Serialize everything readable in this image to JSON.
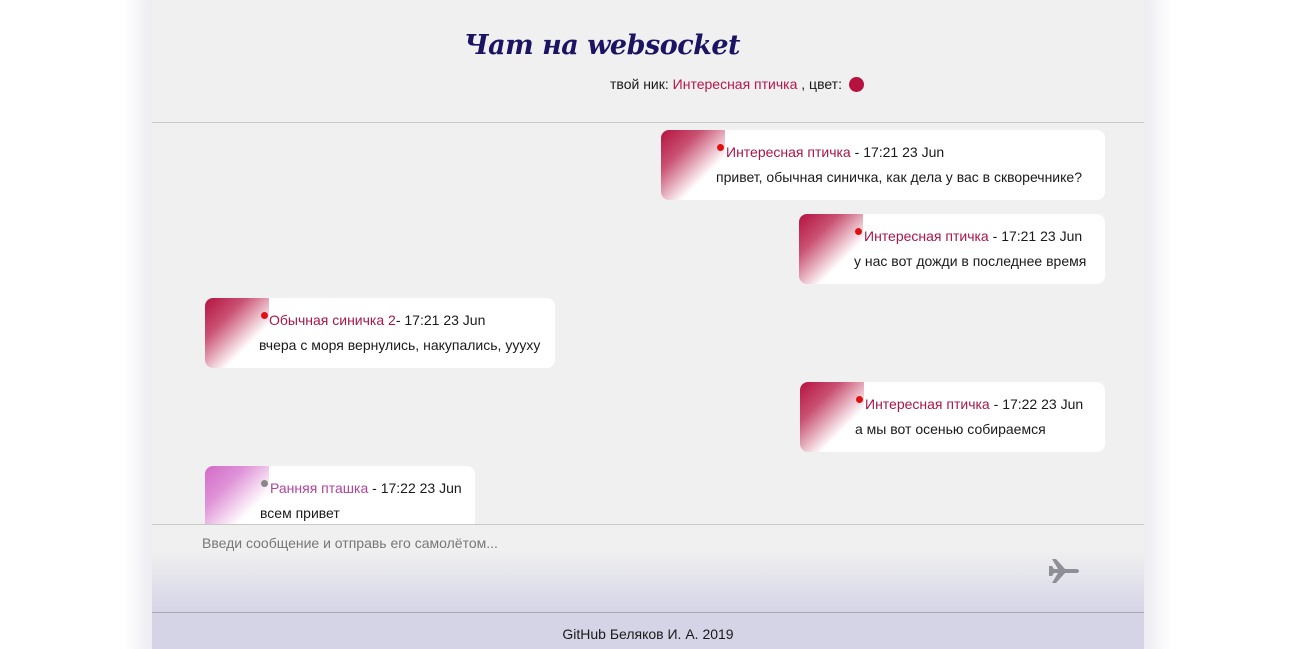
{
  "header": {
    "title": "Чат на websocket",
    "nick_prefix": "твой ник: ",
    "nick": "Интересная птичка",
    "color_label": " , цвет: ",
    "user_color": "#b5123f"
  },
  "messages": [
    {
      "side": "right",
      "author": "Интересная птичка",
      "sep": " - ",
      "time": "17:21 23 Jun",
      "text": "привет, обычная синичка, как дела у вас в скворечнике?",
      "author_color": "#a8164a",
      "stripe_color": "#b5123f",
      "status": "online",
      "status_color": "#e01010"
    },
    {
      "side": "right",
      "author": "Интересная птичка",
      "sep": " - ",
      "time": "17:21 23 Jun",
      "text": "у нас вот дожди в последнее время",
      "author_color": "#a8164a",
      "stripe_color": "#b5123f",
      "status": "online",
      "status_color": "#e01010"
    },
    {
      "side": "left",
      "author": "Обычная синичка 2",
      "sep": "- ",
      "time": "17:21 23 Jun",
      "text": "вчера с моря вернулись, накупались, уууху",
      "author_color": "#a8164a",
      "stripe_color": "#b5123f",
      "status": "online",
      "status_color": "#e01010"
    },
    {
      "side": "right",
      "author": "Интересная птичка",
      "sep": " - ",
      "time": "17:22 23 Jun",
      "text": "а мы вот осенью собираемся",
      "author_color": "#a8164a",
      "stripe_color": "#b5123f",
      "status": "online",
      "status_color": "#e01010"
    },
    {
      "side": "left",
      "author": "Ранняя пташка",
      "sep": " - ",
      "time": "17:22 23 Jun",
      "text": "всем привет",
      "author_color": "#b0449a",
      "stripe_color": "#d36ac8",
      "status": "offline",
      "status_color": "#888888"
    }
  ],
  "composer": {
    "placeholder": "Введи сообщение и отправь его самолётом...",
    "send_icon": "airplane-icon"
  },
  "footer": {
    "text": "GitHub Беляков И. А. 2019"
  }
}
